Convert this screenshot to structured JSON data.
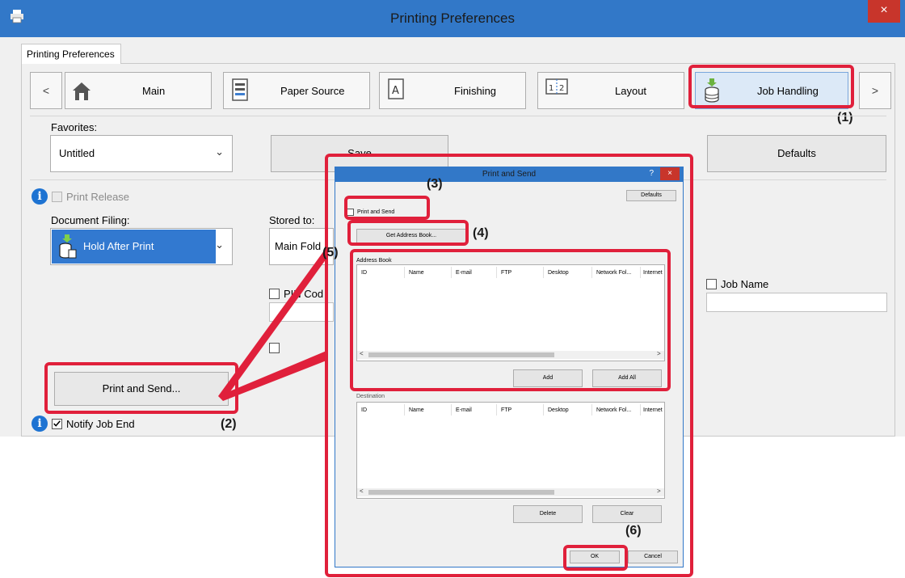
{
  "window": {
    "title": "Printing Preferences",
    "close": "×"
  },
  "outer_tab": "Printing Preferences",
  "nav": {
    "prev": "<",
    "next": ">",
    "tabs": [
      {
        "label": "Main",
        "icon": "home-icon"
      },
      {
        "label": "Paper Source",
        "icon": "paper-tray-icon"
      },
      {
        "label": "Finishing",
        "icon": "finishing-icon"
      },
      {
        "label": "Layout",
        "icon": "layout-icon"
      },
      {
        "label": "Job Handling",
        "icon": "job-handling-icon"
      }
    ]
  },
  "favorites": {
    "label": "Favorites:",
    "value": "Untitled",
    "save_label": "Save",
    "defaults_label": "Defaults"
  },
  "print_release": {
    "label": "Print Release",
    "checked": false
  },
  "document_filing": {
    "label": "Document Filing:",
    "value": "Hold After Print"
  },
  "stored_to": {
    "label": "Stored to:",
    "value": "Main Fold"
  },
  "pin_code": {
    "label": "PIN Cod"
  },
  "job_name": {
    "label": "Job Name",
    "value": ""
  },
  "print_and_send_button": "Print and Send...",
  "notify_job_end": {
    "label": "Notify Job End",
    "checked": true
  },
  "steps": {
    "s1": "(1)",
    "s2": "(2)",
    "s3": "(3)",
    "s4": "(4)",
    "s5": "(5)",
    "s6": "(6)"
  },
  "dialog": {
    "title": "Print and Send",
    "help": "?",
    "close": "×",
    "defaults": "Defaults",
    "print_and_send": "Print and Send",
    "get_address_book": "Get Address Book...",
    "address_book_label": "Address Book",
    "columns": [
      "ID",
      "Name",
      "E-mail",
      "FTP",
      "Desktop",
      "Network Fol...",
      "Internet"
    ],
    "add": "Add",
    "add_all": "Add All",
    "destination_label": "Destination",
    "delete": "Delete",
    "clear": "Clear",
    "ok": "OK",
    "cancel": "Cancel",
    "scroll_left": "<",
    "scroll_right": ">"
  },
  "colors": {
    "titlebar": "#3278c8",
    "close": "#c8352b",
    "highlight": "#e0203b"
  }
}
